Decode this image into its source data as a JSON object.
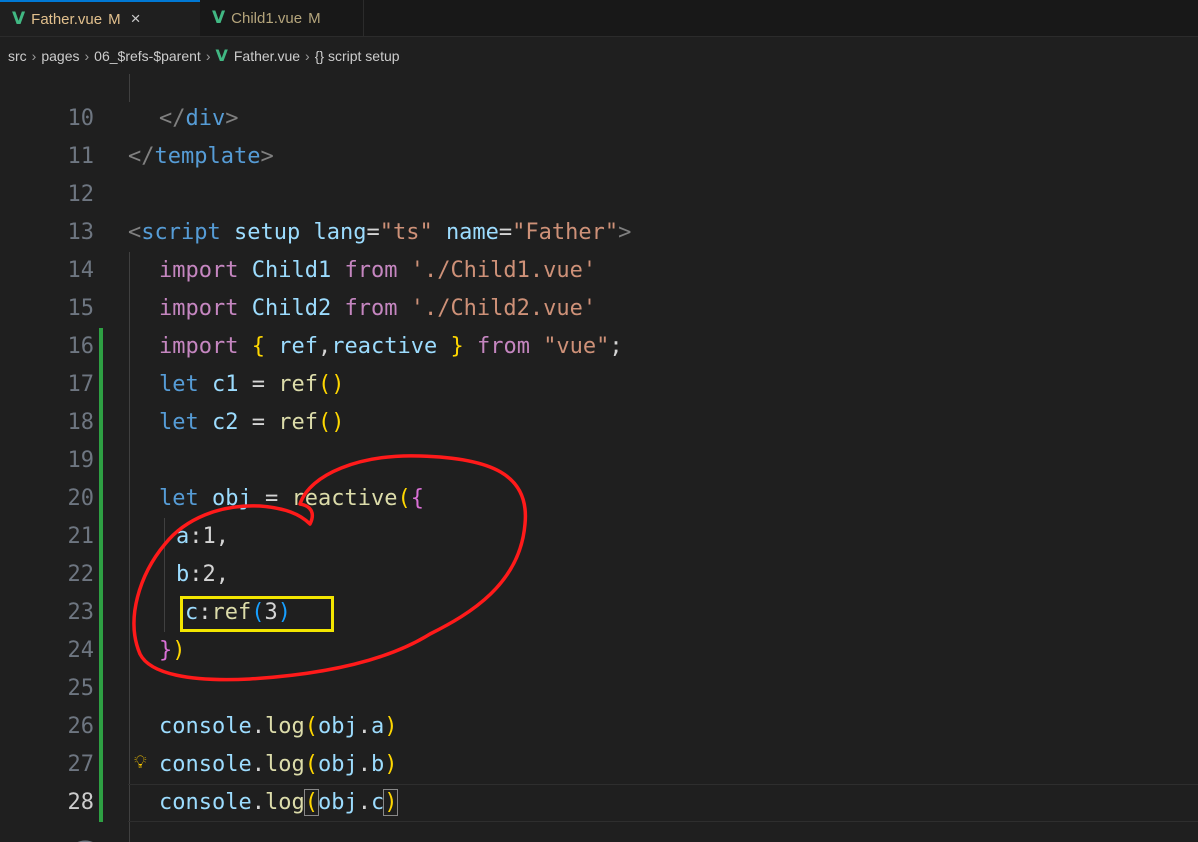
{
  "tabs": [
    {
      "label": "Father.vue",
      "modified": "M",
      "close": "×"
    },
    {
      "label": "Child1.vue",
      "modified": "M"
    }
  ],
  "breadcrumb": {
    "src": "src",
    "pages": "pages",
    "folder": "06_$refs-$parent",
    "file": "Father.vue",
    "symbol": "{} script setup"
  },
  "editor": {
    "active_line": "28",
    "lines": [
      {
        "n": "10"
      },
      {
        "n": "11"
      },
      {
        "n": "12"
      },
      {
        "n": "13"
      },
      {
        "n": "14"
      },
      {
        "n": "15"
      },
      {
        "n": "16"
      },
      {
        "n": "17"
      },
      {
        "n": "18"
      },
      {
        "n": "19"
      },
      {
        "n": "20"
      },
      {
        "n": "21"
      },
      {
        "n": "22"
      },
      {
        "n": "23"
      },
      {
        "n": "24"
      },
      {
        "n": "25"
      },
      {
        "n": "26"
      },
      {
        "n": "27"
      },
      {
        "n": "28"
      }
    ],
    "tokens": {
      "l10": [
        "</",
        "div",
        ">"
      ],
      "l11": [
        "</",
        "template",
        ">"
      ],
      "l13": [
        "<",
        "script",
        " ",
        "setup",
        " ",
        "lang",
        "=",
        "\"ts\"",
        " ",
        "name",
        "=",
        "\"Father\"",
        ">"
      ],
      "l14": [
        "import",
        " ",
        "Child1",
        " ",
        "from",
        " ",
        "'./Child1.vue'"
      ],
      "l15": [
        "import",
        " ",
        "Child2",
        " ",
        "from",
        " ",
        "'./Child2.vue'"
      ],
      "l16": [
        "import",
        " ",
        "{",
        " ",
        "ref",
        ",",
        "reactive",
        " ",
        "}",
        " ",
        "from",
        " ",
        "\"vue\"",
        ";"
      ],
      "l17": [
        "let",
        " ",
        "c1",
        " = ",
        "ref",
        "()"
      ],
      "l18": [
        "let",
        " ",
        "c2",
        " = ",
        "ref",
        "()"
      ],
      "l20": [
        "let",
        " ",
        "obj",
        " = ",
        "reactive",
        "(",
        "{"
      ],
      "l21": [
        "a",
        ":",
        "1",
        ","
      ],
      "l22": [
        "b",
        ":",
        "2",
        ","
      ],
      "l23": [
        "c",
        ":",
        "ref",
        "(",
        "3",
        ")"
      ],
      "l24": [
        "}",
        ")"
      ],
      "l26": [
        "console",
        ".",
        "log",
        "(",
        "obj",
        ".",
        "a",
        ")"
      ],
      "l27": [
        "console",
        ".",
        "log",
        "(",
        "obj",
        ".",
        "b",
        ")"
      ],
      "l28": [
        "console",
        ".",
        "log",
        "(",
        "obj",
        ".",
        "c",
        ")"
      ]
    }
  },
  "colors": {
    "annotation_red": "#ff1a1a",
    "annotation_yellow": "#f3e600",
    "vue_green": "#41b883"
  },
  "icons": [
    "vue-icon",
    "close-icon",
    "lightbulb-icon",
    "braces-icon"
  ]
}
